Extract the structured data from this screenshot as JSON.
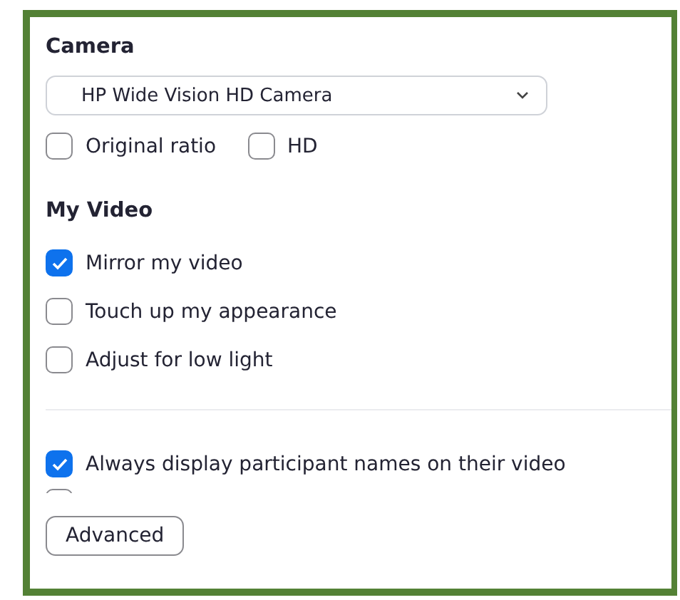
{
  "camera": {
    "heading": "Camera",
    "device": "HP Wide Vision HD Camera",
    "options": [
      {
        "label": "Original ratio",
        "checked": false
      },
      {
        "label": "HD",
        "checked": false
      }
    ]
  },
  "my_video": {
    "heading": "My Video",
    "options": [
      {
        "label": "Mirror my video",
        "checked": true
      },
      {
        "label": "Touch up my appearance",
        "checked": false
      },
      {
        "label": "Adjust for low light",
        "checked": false
      }
    ]
  },
  "display_options": [
    {
      "label": "Always display participant names on their video",
      "checked": true
    }
  ],
  "clipped_checkbox": {
    "checked": false
  },
  "advanced_button": "Advanced"
}
